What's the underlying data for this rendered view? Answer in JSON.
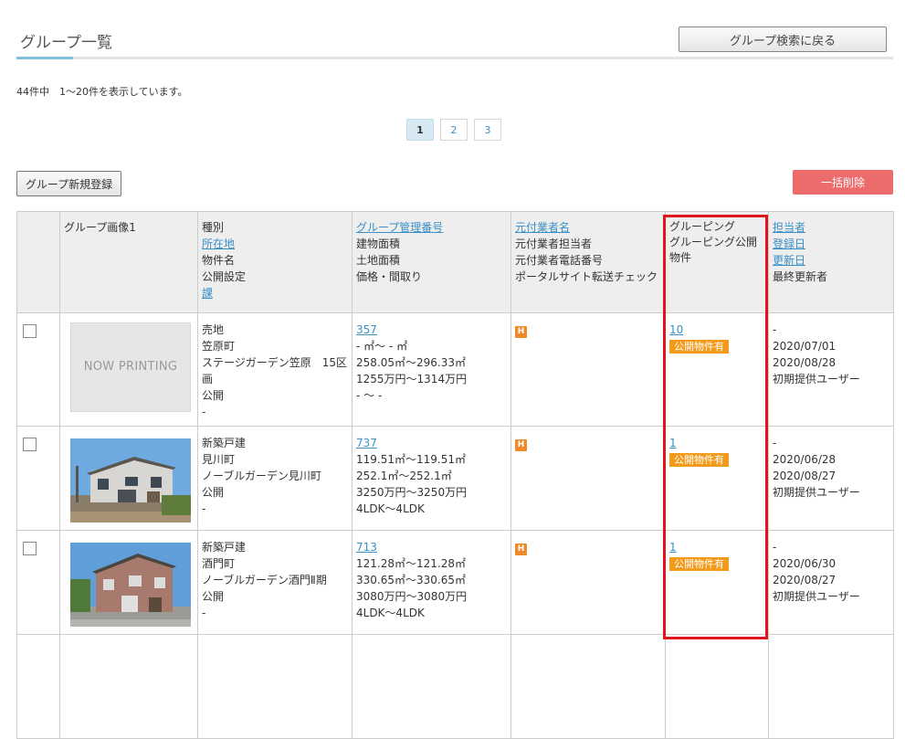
{
  "header": {
    "title": "グループ一覧",
    "back_button": "グループ検索に戻る"
  },
  "summary": {
    "count_text": "44件中　1〜20件を表示しています。"
  },
  "pagination": {
    "pages": [
      "1",
      "2",
      "3"
    ],
    "current": "1"
  },
  "actions": {
    "new_button": "グループ新規登録",
    "bulk_delete": "一括削除"
  },
  "table": {
    "headers": {
      "image": "グループ画像1",
      "col2": [
        "種別",
        "所在地",
        "物件名",
        "公開設定",
        "課"
      ],
      "col3": [
        "グループ管理番号",
        "建物面積",
        "土地面積",
        "価格・間取り"
      ],
      "col4": [
        "元付業者名",
        "元付業者担当者",
        "元付業者電話番号",
        "ポータルサイト転送チェック"
      ],
      "col5": [
        "グルーピング",
        "グルーピング公開",
        "物件"
      ],
      "col6": [
        "担当者",
        "登録日",
        "更新日",
        "最終更新者"
      ]
    },
    "rows": [
      {
        "image_placeholder": "NOW PRINTING",
        "col2": [
          "売地",
          "笠原町",
          "ステージガーデン笠原　15区画",
          "公開",
          "-"
        ],
        "id": "357",
        "col3": [
          "- ㎡〜 - ㎡",
          "258.05㎡〜296.33㎡",
          "1255万円〜1314万円",
          "- 〜 -"
        ],
        "portal_badge": "H",
        "group_count": "10",
        "public_badge": "公開物件有",
        "col6": [
          "-",
          "2020/07/01",
          "2020/08/28",
          "初期提供ユーザー"
        ]
      },
      {
        "col2": [
          "新築戸建",
          "見川町",
          "ノーブルガーデン見川町",
          "公開",
          "-"
        ],
        "id": "737",
        "col3": [
          "119.51㎡〜119.51㎡",
          "252.1㎡〜252.1㎡",
          "3250万円〜3250万円",
          "4LDK〜4LDK"
        ],
        "portal_badge": "H",
        "group_count": "1",
        "public_badge": "公開物件有",
        "col6": [
          "-",
          "2020/06/28",
          "2020/08/27",
          "初期提供ユーザー"
        ]
      },
      {
        "col2": [
          "新築戸建",
          "酒門町",
          "ノーブルガーデン酒門Ⅱ期",
          "公開",
          "-"
        ],
        "id": "713",
        "col3": [
          "121.28㎡〜121.28㎡",
          "330.65㎡〜330.65㎡",
          "3080万円〜3080万円",
          "4LDK〜4LDK"
        ],
        "portal_badge": "H",
        "group_count": "1",
        "public_badge": "公開物件有",
        "col6": [
          "-",
          "2020/06/30",
          "2020/08/27",
          "初期提供ユーザー"
        ]
      }
    ]
  },
  "colors": {
    "accent": "#3a8fc6",
    "delete": "#ec6b6b",
    "badge_orange": "#f39a1b",
    "highlight": "#e0141e"
  }
}
